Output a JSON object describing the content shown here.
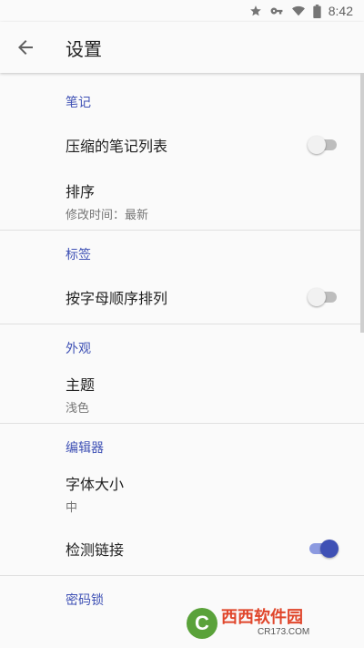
{
  "status_bar": {
    "time": "8:42",
    "icons": [
      "star-icon",
      "key-icon",
      "wifi-icon",
      "battery-icon"
    ]
  },
  "app_bar": {
    "back_icon": "arrow-back-icon",
    "title": "设置"
  },
  "sections": {
    "notes": {
      "header": "笔记",
      "compact_list": {
        "title": "压缩的笔记列表",
        "enabled": false
      },
      "sort": {
        "title": "排序",
        "summary": "修改时间：最新"
      }
    },
    "tags": {
      "header": "标签",
      "alphabetical": {
        "title": "按字母顺序排列",
        "enabled": false
      }
    },
    "appearance": {
      "header": "外观",
      "theme": {
        "title": "主题",
        "summary": "浅色"
      }
    },
    "editor": {
      "header": "编辑器",
      "font_size": {
        "title": "字体大小",
        "summary": "中"
      },
      "detect_links": {
        "title": "检测链接",
        "enabled": true
      }
    },
    "passcode": {
      "header": "密码锁"
    }
  },
  "watermark": {
    "text": "西西软件园",
    "sub": "CR173.COM"
  },
  "colors": {
    "accent": "#3f51b5",
    "background": "#fafafa",
    "divider": "#e0e0e0"
  }
}
